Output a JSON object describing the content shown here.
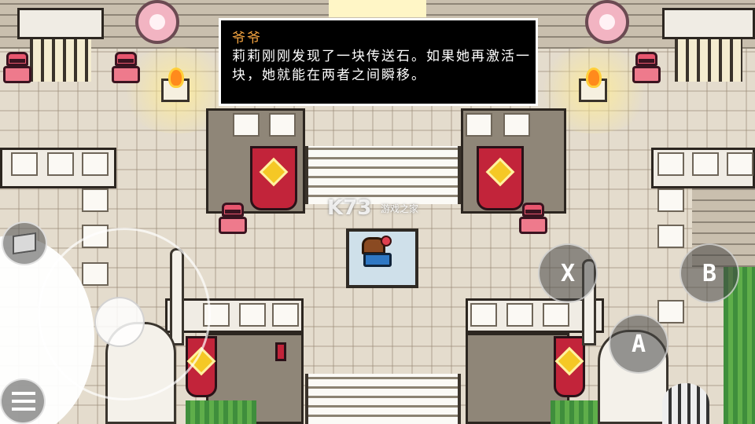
{
  "dialog": {
    "speaker": "爷爷",
    "message": "莉莉刚刚发现了一块传送石。如果她再激活一块，她就能在两者之间瞬移。"
  },
  "controls": {
    "x_label": "X",
    "b_label": "B",
    "a_label": "A"
  },
  "watermark": {
    "logo": "K73",
    "sub": "游戏之家"
  },
  "colors": {
    "dialog_bg": "#000000",
    "speaker": "#f2a340",
    "banner": "#c2243a",
    "guard": "#ee7a8c"
  }
}
